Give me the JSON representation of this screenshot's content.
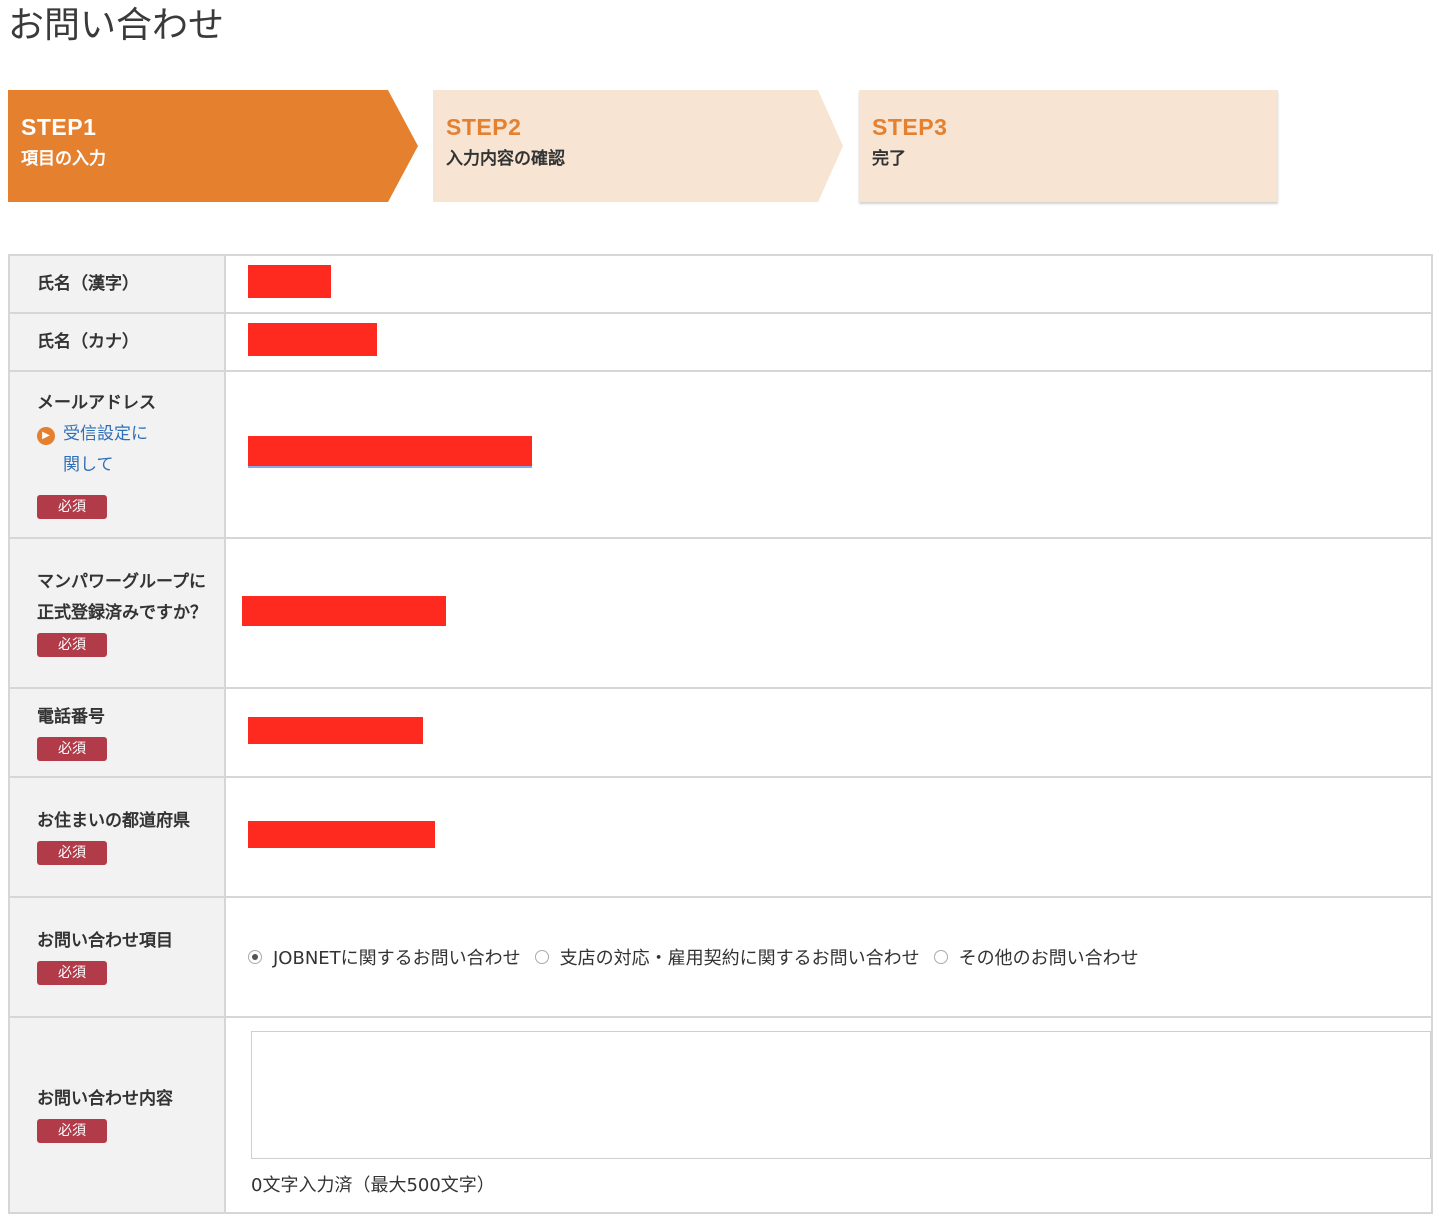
{
  "page": {
    "title": "お問い合わせ"
  },
  "steps": [
    {
      "num": "STEP1",
      "label": "項目の入力"
    },
    {
      "num": "STEP2",
      "label": "入力内容の確認"
    },
    {
      "num": "STEP3",
      "label": "完了"
    }
  ],
  "required_label": "必須",
  "fields": {
    "name_kanji": {
      "label": "氏名（漢字）"
    },
    "name_kana": {
      "label": "氏名（カナ）"
    },
    "email": {
      "label": "メールアドレス",
      "help_link": "受信設定に関して"
    },
    "registered": {
      "label": "マンパワーグループに正式登録済みですか？"
    },
    "phone": {
      "label": "電話番号"
    },
    "prefecture": {
      "label": "お住まいの都道府県"
    },
    "inquiry_type": {
      "label": "お問い合わせ項目",
      "options": [
        "JOBNETに関するお問い合わせ",
        "支店の対応・雇用契約に関するお問い合わせ",
        "その他のお問い合わせ"
      ],
      "selected_index": 0
    },
    "inquiry_content": {
      "label": "お問い合わせ内容",
      "value": "",
      "counter": "0文字入力済（最大500文字）"
    }
  },
  "colors": {
    "accent": "#e5802f",
    "step_inactive": "#f7e4d3",
    "required_badge": "#b23b4a",
    "redaction": "#ff2a1f",
    "link": "#2f6fb7"
  }
}
